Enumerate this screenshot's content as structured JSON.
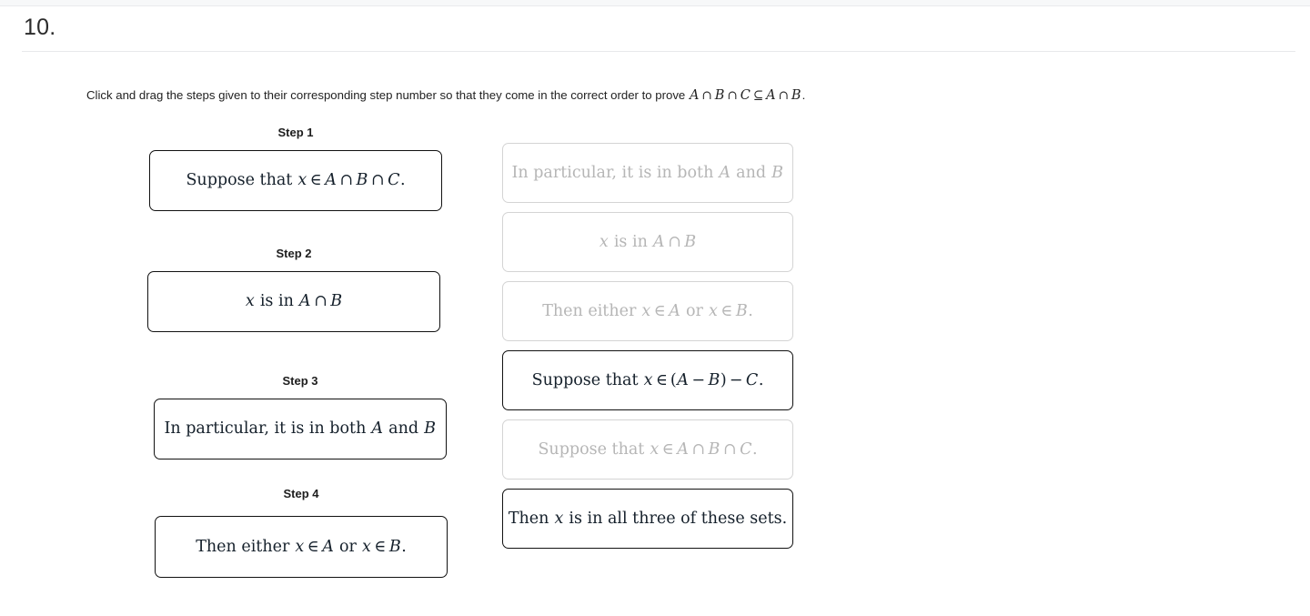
{
  "header": {
    "question_number": "10."
  },
  "prompt": {
    "text_before": "Click and drag the steps given to their corresponding step number so that they come in the correct order to prove",
    "math": "A ∩ B ∩ C ⊆ A ∩ B.",
    "math_parts": {
      "a1": "A",
      "cap1": "∩",
      "b1": "B",
      "cap2": "∩",
      "c1": "C",
      "subseteq": "⊆",
      "a2": "A",
      "cap3": "∩",
      "b2": "B",
      "period": "."
    }
  },
  "steps": [
    {
      "label": "Step 1",
      "content": "Suppose that x ∈ A ∩ B ∩ C.",
      "parts": {
        "lead": "Suppose that",
        "v1": "x",
        "in": "∈",
        "s1": "A",
        "op1": "∩",
        "s2": "B",
        "op2": "∩",
        "s3": "C",
        "end": "."
      }
    },
    {
      "label": "Step 2",
      "content": "x is in A ∩ B",
      "parts": {
        "v1": "x",
        "lead": "is in",
        "s1": "A",
        "op1": "∩",
        "s2": "B"
      }
    },
    {
      "label": "Step 3",
      "content": "In particular, it is in both A and B",
      "parts": {
        "lead": "In particular, it is in both",
        "s1": "A",
        "mid": "and",
        "s2": "B"
      }
    },
    {
      "label": "Step 4",
      "content": "Then either x ∈ A or x ∈ B.",
      "parts": {
        "lead": "Then either",
        "v1": "x",
        "in1": "∈",
        "s1": "A",
        "mid": "or",
        "v2": "x",
        "in2": "∈",
        "s2": "B",
        "end": "."
      }
    }
  ],
  "bank": [
    {
      "content": "In particular, it is in both A and B",
      "state": "used",
      "parts": {
        "lead": "In particular, it is in both",
        "s1": "A",
        "mid": "and",
        "s2": "B"
      }
    },
    {
      "content": "x is in A ∩ B",
      "state": "used",
      "parts": {
        "v1": "x",
        "lead": "is in",
        "s1": "A",
        "op1": "∩",
        "s2": "B"
      }
    },
    {
      "content": "Then either x ∈ A or x ∈ B.",
      "state": "used",
      "parts": {
        "lead": "Then either",
        "v1": "x",
        "in1": "∈",
        "s1": "A",
        "mid": "or",
        "v2": "x",
        "in2": "∈",
        "s2": "B",
        "end": "."
      }
    },
    {
      "content": "Suppose that x ∈ (A − B) − C.",
      "state": "active",
      "parts": {
        "lead": "Suppose that",
        "v1": "x",
        "in": "∈",
        "open": "(",
        "s1": "A",
        "minus1": "−",
        "s2": "B",
        "close": ")",
        "minus2": "−",
        "s3": "C",
        "end": "."
      }
    },
    {
      "content": "Suppose that x ∈ A ∩ B ∩ C.",
      "state": "used",
      "parts": {
        "lead": "Suppose that",
        "v1": "x",
        "in": "∈",
        "s1": "A",
        "op1": "∩",
        "s2": "B",
        "op2": "∩",
        "s3": "C",
        "end": "."
      }
    },
    {
      "content": "Then x is in all three of these sets.",
      "state": "active",
      "parts": {
        "lead": "Then",
        "v1": "x",
        "tail": "is in all three of these sets."
      }
    }
  ],
  "colors": {
    "text": "#15202b",
    "dimmed_text": "#b6b6b6",
    "active_border": "#111111",
    "used_border": "#d4d4d4",
    "divider": "#e8e9eb",
    "top_strip": "#f7f8f9"
  }
}
